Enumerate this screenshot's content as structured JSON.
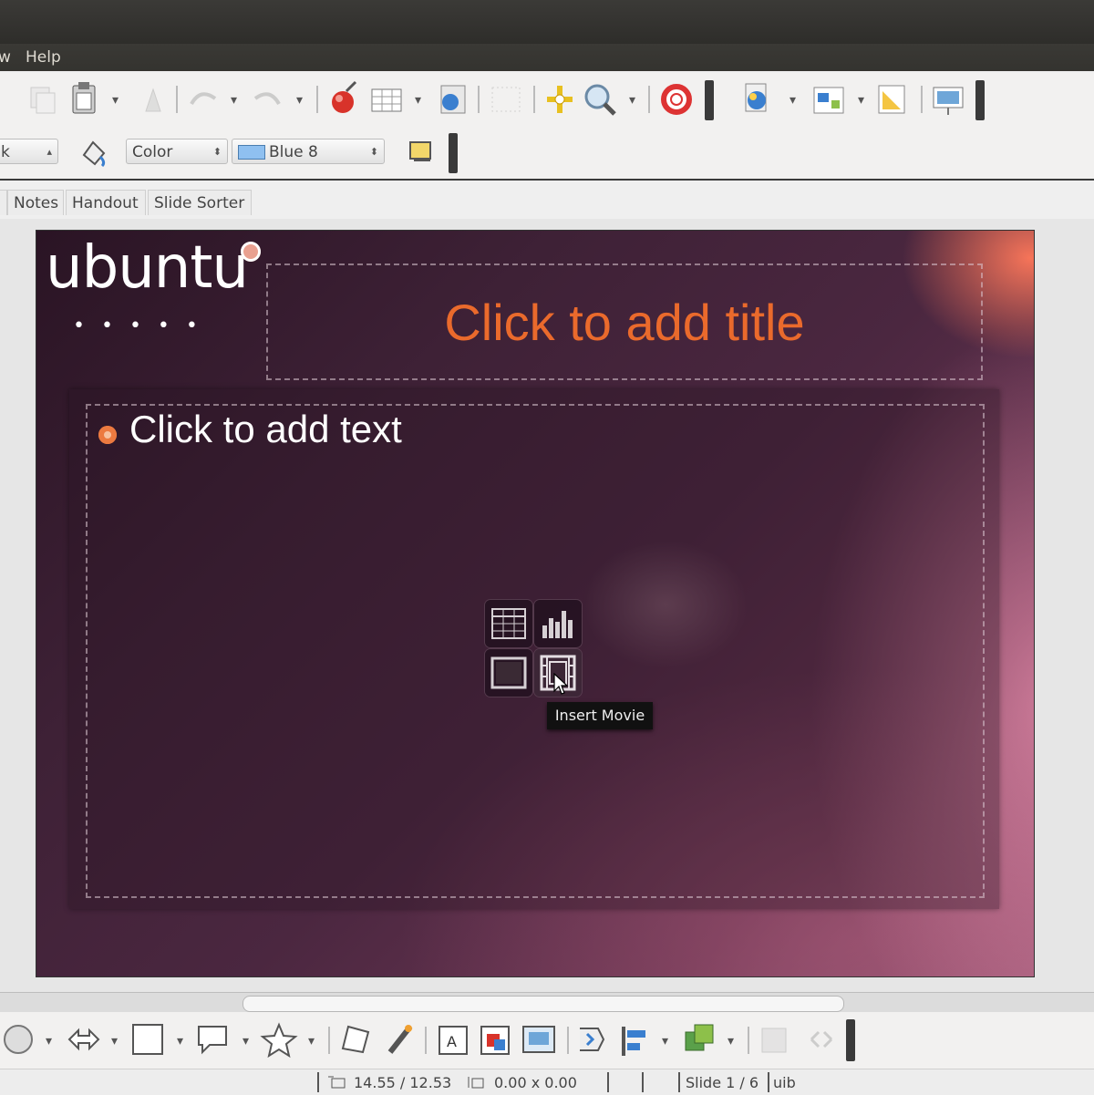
{
  "menubar": {
    "partial_item": "w",
    "help": "Help"
  },
  "format_bar": {
    "line_style_partial": "k",
    "area_style": "Color",
    "area_color": "Blue 8",
    "area_color_swatch": "#8fc0f0"
  },
  "view_tabs": [
    "Notes",
    "Handout",
    "Slide Sorter"
  ],
  "slide": {
    "logo_text": "ubuntu",
    "title_placeholder": "Click to add title",
    "content_placeholder": "Click to add text",
    "title_color": "#ea6a2c",
    "bullet_color": "#ec7a40"
  },
  "insert_icons": [
    "table-icon",
    "chart-icon",
    "image-icon",
    "movie-icon"
  ],
  "tooltip": "Insert Movie",
  "status_bar": {
    "position": "14.55 / 12.53",
    "size": "0.00 x 0.00",
    "slide": "Slide 1 / 6",
    "layout_partial": "uib"
  }
}
